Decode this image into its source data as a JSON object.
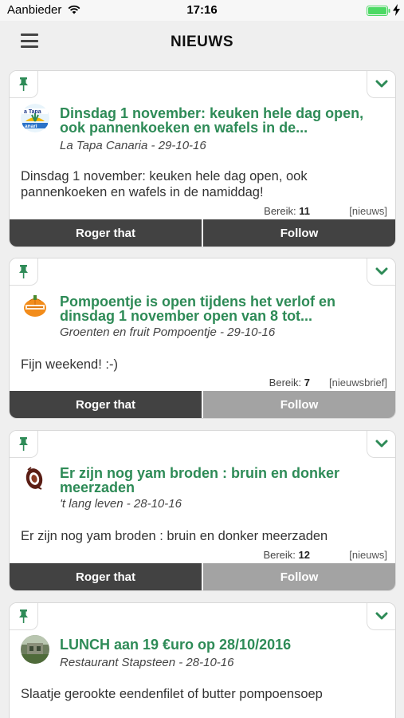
{
  "status_bar": {
    "carrier": "Aanbieder",
    "time": "17:16"
  },
  "header": {
    "title": "NIEUWS"
  },
  "posts": [
    {
      "title": "Dinsdag 1 november: keuken hele dag open, ook pannenkoeken en wafels in de...",
      "author": "La Tapa Canaria",
      "date": "29-10-16",
      "meta": "La Tapa Canaria - 29-10-16",
      "body": "Dinsdag 1 november: keuken hele dag open, ook pannenkoeken en wafels in de namiddag!",
      "reach_label": "Bereik:",
      "reach_value": "11",
      "tag": "[nieuws]",
      "ack_label": "Roger that",
      "follow_label": "Follow",
      "following": false
    },
    {
      "title": "Pompoentje is open tijdens het verlof en dinsdag 1 november open van 8 tot...",
      "author": "Groenten en fruit Pompoentje",
      "date": "29-10-16",
      "meta": "Groenten en fruit Pompoentje - 29-10-16",
      "body": "Fijn weekend! :-)",
      "reach_label": "Bereik:",
      "reach_value": "7",
      "tag": "[nieuwsbrief]",
      "ack_label": "Roger that",
      "follow_label": "Follow",
      "following": true
    },
    {
      "title": "Er zijn nog yam broden : bruin en donker meerzaden",
      "author": "'t lang leven",
      "date": "28-10-16",
      "meta": "'t lang leven - 28-10-16",
      "body": "Er zijn nog yam broden : bruin en donker meerzaden",
      "reach_label": "Bereik:",
      "reach_value": "12",
      "tag": "[nieuws]",
      "ack_label": "Roger that",
      "follow_label": "Follow",
      "following": true
    },
    {
      "title": "LUNCH aan 19 €uro op 28/10/2016",
      "author": "Restaurant Stapsteen",
      "date": "28-10-16",
      "meta": "Restaurant Stapsteen - 28-10-16",
      "body": "Slaatje gerookte eendenfilet of butter pompoensoep"
    }
  ],
  "colors": {
    "accent_green": "#2e8b57",
    "button_dark": "#424242",
    "button_disabled": "#a3a3a3",
    "battery_green": "#4cd964"
  },
  "icons": [
    "wifi-icon",
    "battery-icon",
    "charging-icon",
    "menu-icon",
    "pin-icon",
    "chevron-down-icon"
  ]
}
